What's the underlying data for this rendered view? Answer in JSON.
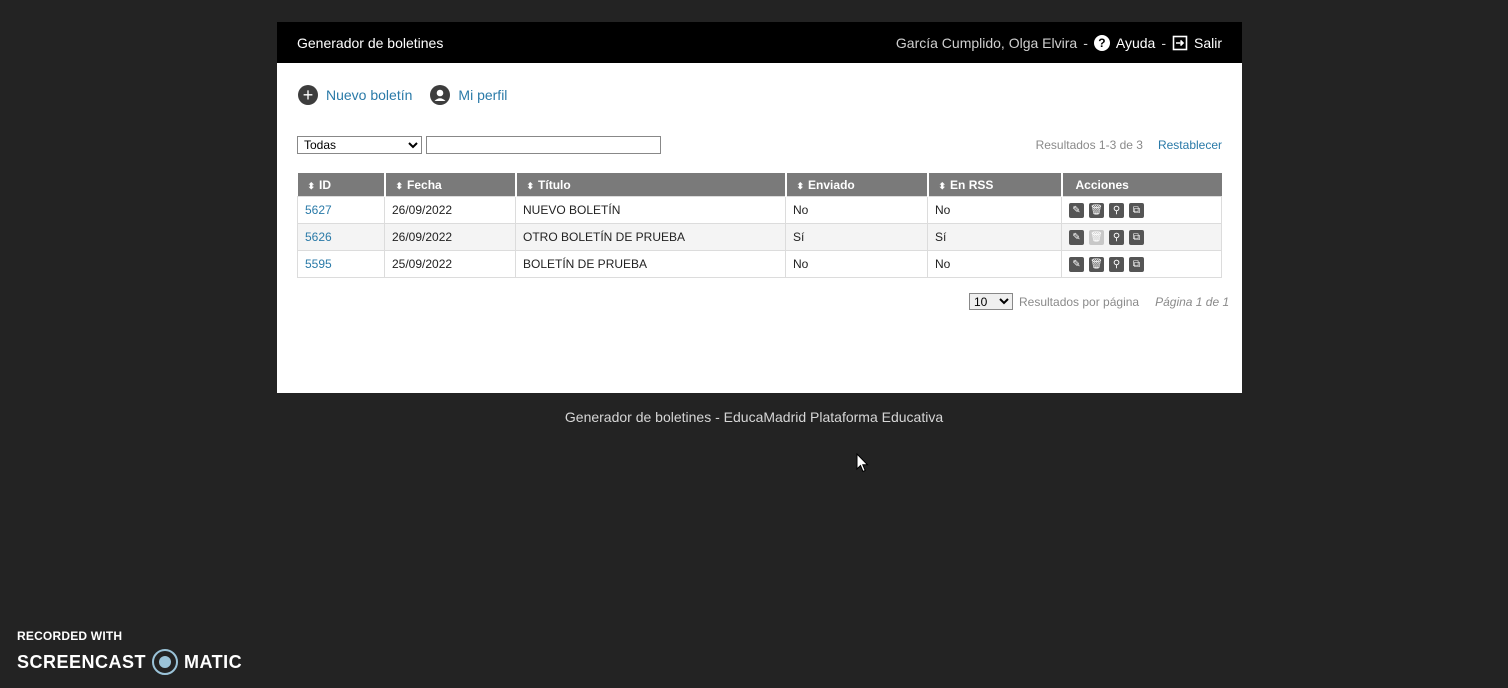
{
  "header": {
    "title": "Generador de boletines",
    "user": "García Cumplido, Olga Elvira",
    "separator": "-",
    "help": "Ayuda",
    "logout": "Salir"
  },
  "actions": {
    "new": "Nuevo boletín",
    "profile": "Mi perfil"
  },
  "filter": {
    "select_value": "Todas",
    "search_value": "",
    "results": "Resultados 1-3 de 3",
    "reset": "Restablecer"
  },
  "table": {
    "headers": [
      "ID",
      "Fecha",
      "Título",
      "Enviado",
      "En RSS",
      "Acciones"
    ],
    "rows": [
      {
        "id": "5627",
        "date": "26/09/2022",
        "title": "NUEVO BOLETÍN",
        "sent": "No",
        "rss": "No",
        "delete_enabled": true
      },
      {
        "id": "5626",
        "date": "26/09/2022",
        "title": "OTRO BOLETÍN DE PRUEBA",
        "sent": "Sí",
        "rss": "Sí",
        "delete_enabled": false
      },
      {
        "id": "5595",
        "date": "25/09/2022",
        "title": "BOLETÍN DE PRUEBA",
        "sent": "No",
        "rss": "No",
        "delete_enabled": true
      }
    ]
  },
  "pager": {
    "per_page": "10",
    "per_page_label": "Resultados por página",
    "page_label": "Página 1 de 1"
  },
  "footer": "Generador de boletines - EducaMadrid Plataforma Educativa",
  "watermark": {
    "recorded": "RECORDED WITH",
    "brand_left": "SCREENCAST",
    "brand_right": "MATIC"
  },
  "icons": {
    "edit": "pencil-icon",
    "delete": "trash-icon",
    "view": "magnifier-icon",
    "copy": "copy-icon"
  }
}
